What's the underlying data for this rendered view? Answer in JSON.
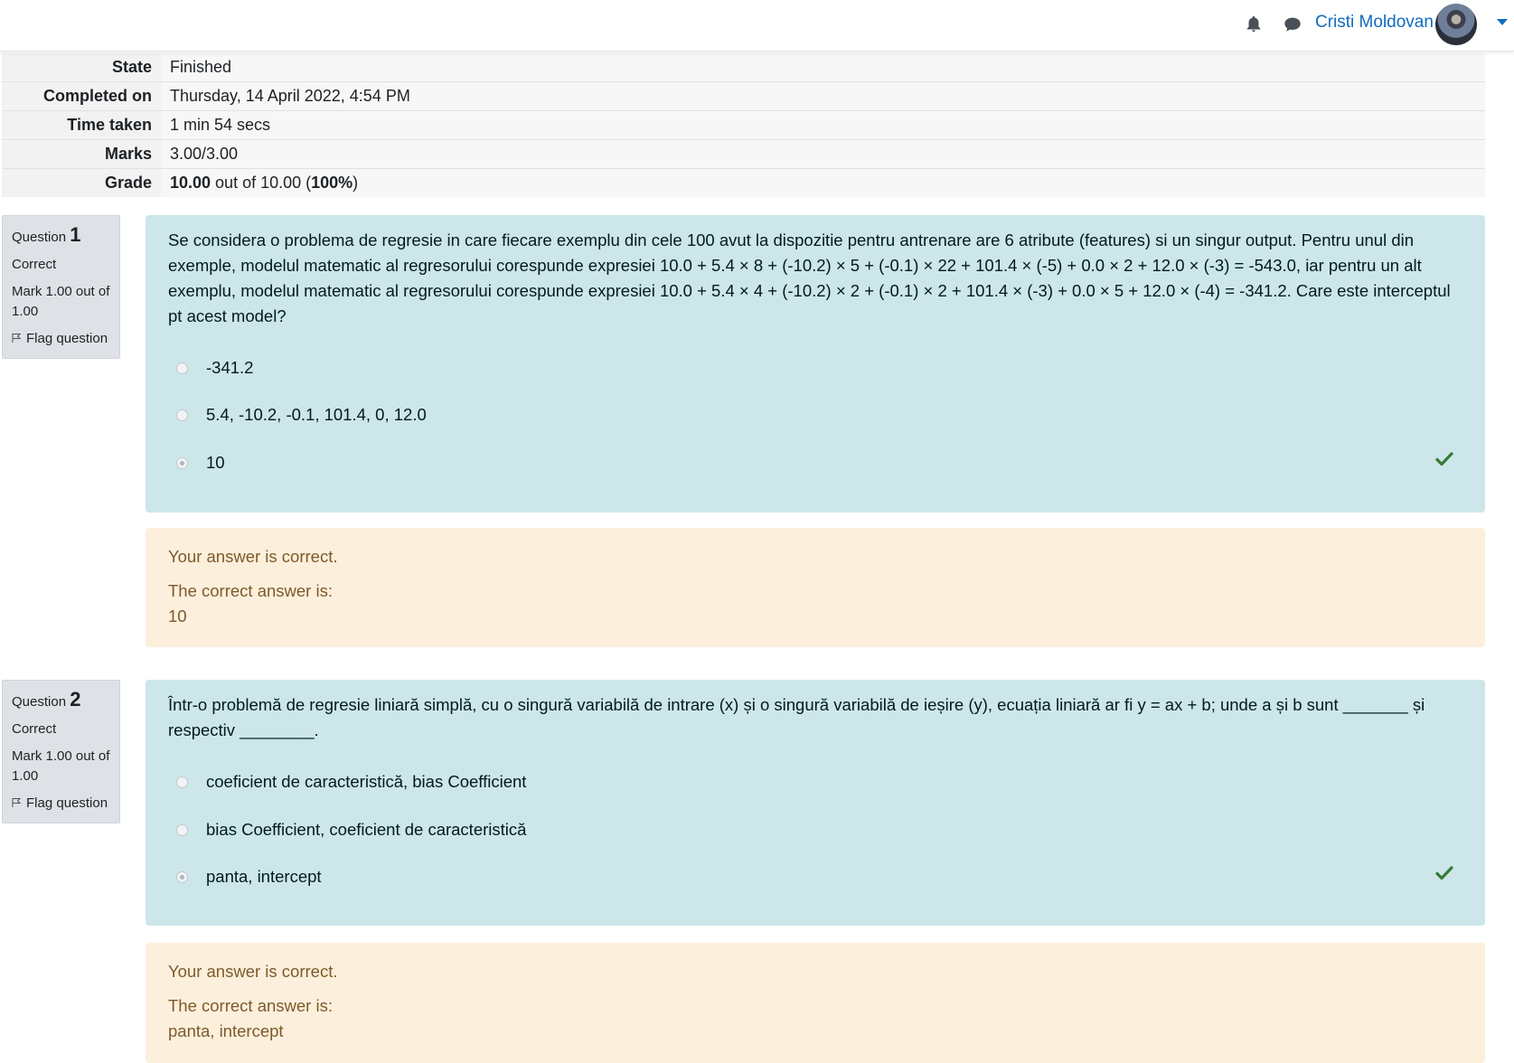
{
  "user": {
    "name": "Cristi Moldovan"
  },
  "summary": [
    {
      "label": "State",
      "value": "Finished"
    },
    {
      "label": "Completed on",
      "value": "Thursday, 14 April 2022, 4:54 PM"
    },
    {
      "label": "Time taken",
      "value": "1 min 54 secs"
    },
    {
      "label": "Marks",
      "value": "3.00/3.00"
    },
    {
      "label": "Grade",
      "value_bold": "10.00",
      "value_mid": " out of 10.00 (",
      "value_pct": "100%",
      "value_end": ")"
    }
  ],
  "questions": [
    {
      "label": "Question",
      "number": "1",
      "state": "Correct",
      "mark": "Mark 1.00 out of 1.00",
      "flag": "Flag question",
      "text": "Se considera o problema de regresie in care fiecare exemplu din cele 100 avut la dispozitie pentru antrenare are 6 atribute (features) si un singur output. Pentru unul din exemple, modelul matematic al regresorului corespunde expresiei 10.0 + 5.4 × 8 + (-10.2) × 5 + (-0.1) × 22 + 101.4 × (-5) + 0.0 × 2 + 12.0 × (-3) = -543.0, iar pentru un alt exemplu, modelul matematic al regresorului corespunde expresiei 10.0 + 5.4 × 4 + (-10.2) × 2 + (-0.1) × 2 + 101.4 × (-3) + 0.0 × 5 + 12.0 × (-4) = -341.2.  Care este interceptul pt acest model?",
      "answers": [
        "-341.2",
        "5.4, -10.2, -0.1, 101.4, 0, 12.0",
        "10"
      ],
      "selected": "10",
      "feedback": "Your answer is correct.",
      "correct_label": "The correct answer is:",
      "correct_answer": "10"
    },
    {
      "label": "Question",
      "number": "2",
      "state": "Correct",
      "mark": "Mark 1.00 out of 1.00",
      "flag": "Flag question",
      "text": "Într-o problemă de regresie liniară simplă, cu o singură variabilă de intrare (x) și o singură variabilă de ieșire (y), ecuația liniară ar fi y = ax + b; unde a și b sunt _______ și respectiv ________.",
      "answers": [
        "coeficient de caracteristică, bias Coefficient",
        "bias Coefficient, coeficient de caracteristică",
        "panta, intercept"
      ],
      "selected": "panta, intercept",
      "feedback": "Your answer is correct.",
      "correct_label": "The correct answer is:",
      "correct_answer": "panta, intercept"
    }
  ]
}
